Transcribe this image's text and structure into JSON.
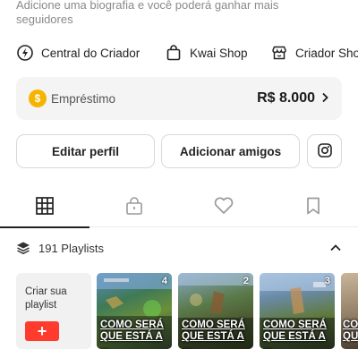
{
  "profile": {
    "bio_prompt": "Adicione uma biografia e você poderá ganhar mais seguidores"
  },
  "shortcuts": [
    {
      "label": "Central do Criador",
      "icon": "lightning-circle-icon"
    },
    {
      "label": "Kwai Shop",
      "icon": "shopping-bag-icon"
    },
    {
      "label": "Criador Sho",
      "icon": "store-icon"
    }
  ],
  "loan": {
    "label": "Empréstimo",
    "icon": "dollar-coin-icon",
    "value": "R$ 8.000"
  },
  "actions": {
    "edit_profile": "Editar perfil",
    "add_friends": "Adicionar amigos",
    "instagram_icon": "instagram-icon"
  },
  "tabs": [
    {
      "name": "grid",
      "icon": "grid-icon",
      "active": true
    },
    {
      "name": "private",
      "icon": "lock-icon",
      "active": false
    },
    {
      "name": "likes",
      "icon": "heart-icon",
      "active": false
    },
    {
      "name": "saved",
      "icon": "bookmark-icon",
      "active": false
    }
  ],
  "playlists": {
    "header": "191 Playlists",
    "create_label": "Criar sua playlist",
    "create_button": "+",
    "items": [
      {
        "count": "4",
        "caption": "COMO SERÁ\nQUE ESTÁ A ..."
      },
      {
        "count": "2",
        "caption": "COMO SERÁ\nQUE ESTÁ A ..."
      },
      {
        "count": "3",
        "caption": "COMO SERÁ\nQUE ESTÁ A ..."
      },
      {
        "count": "",
        "caption": "CO\nQU"
      }
    ]
  },
  "colors": {
    "accent_red": "#fe3b2d",
    "coin_yellow": "#f5b400",
    "card_bg": "#f4f4f5"
  }
}
